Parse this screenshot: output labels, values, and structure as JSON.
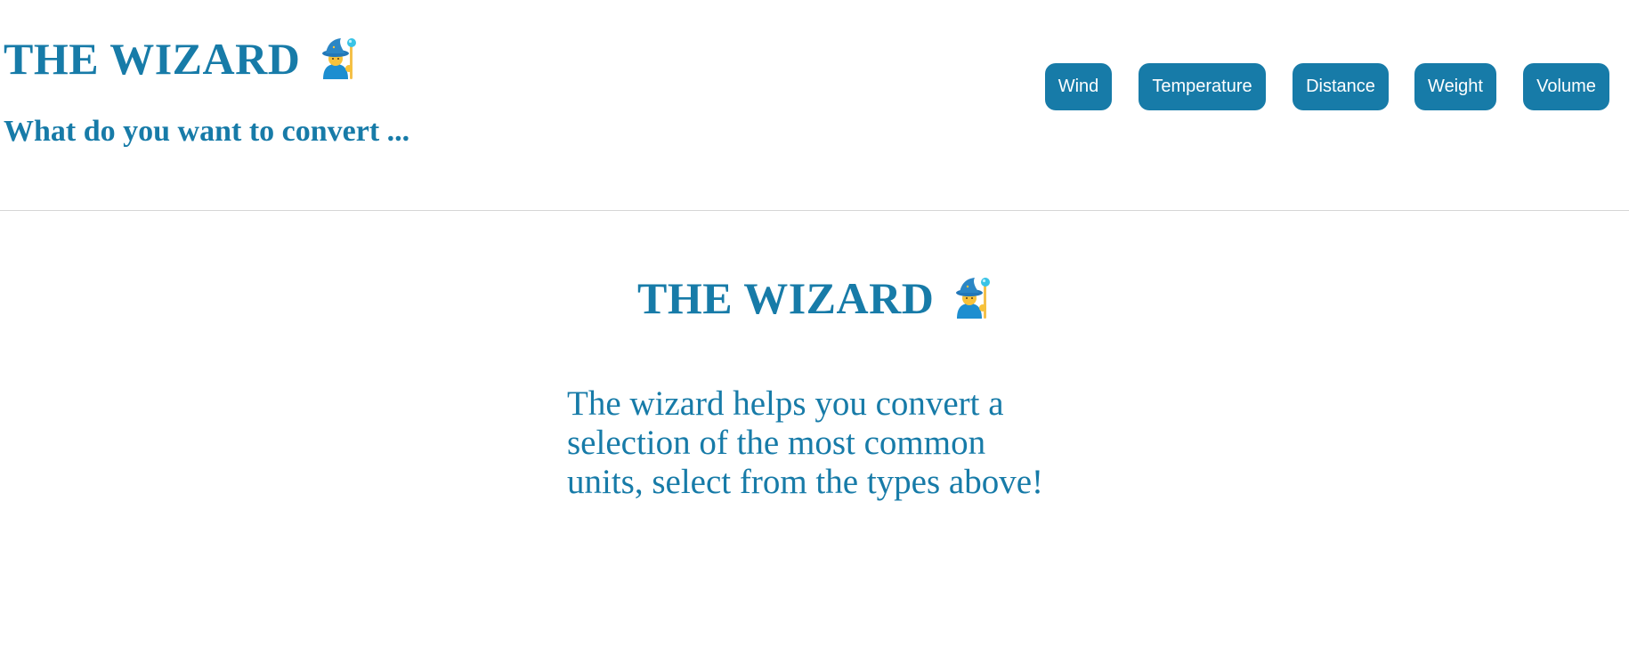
{
  "header": {
    "title": "THE WIZARD",
    "title_icon": "wizard-emoji-icon",
    "subtitle": "What do you want to convert ..."
  },
  "nav": {
    "buttons": [
      {
        "label": "Wind"
      },
      {
        "label": "Temperature"
      },
      {
        "label": "Distance"
      },
      {
        "label": "Weight"
      },
      {
        "label": "Volume"
      }
    ]
  },
  "main": {
    "title": "THE WIZARD",
    "title_icon": "wizard-emoji-icon",
    "description_lines": [
      "The wizard helps you convert a",
      "selection of the most common",
      "units, select from the types above!"
    ]
  },
  "colors": {
    "accent": "#177ba8",
    "button_text": "#ffffff",
    "divider": "#d6d6d6",
    "background": "#ffffff"
  }
}
